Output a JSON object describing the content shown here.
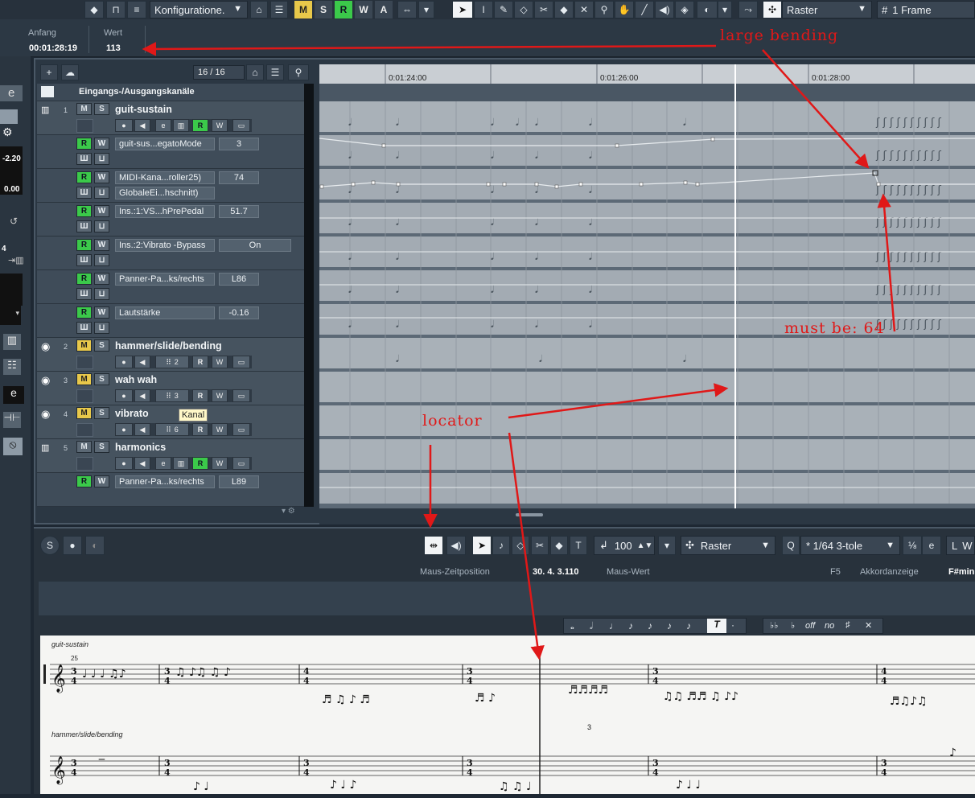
{
  "toolbar": {
    "config_label": "Konfiguratione.",
    "modes": [
      "M",
      "S",
      "R",
      "W",
      "A"
    ],
    "snap_label": "Raster",
    "quantize_label": "1 Frame"
  },
  "infoline": {
    "start_label": "Anfang",
    "start_value": "00:01:28:19",
    "value_label": "Wert",
    "value_value": "113"
  },
  "left_panel": {
    "vals": [
      "-2.20",
      "0.00",
      "4"
    ]
  },
  "project": {
    "track_counter": "16 / 16",
    "folder_name": "Eingangs-/Ausgangskanäle",
    "ruler_labels": [
      "0:01:24:00",
      "0:01:26:00",
      "0:01:28:00"
    ],
    "tracks": [
      {
        "num": "1",
        "name": "guit-sustain"
      },
      {
        "num": "2",
        "name": "hammer/slide/bending",
        "channel": "2"
      },
      {
        "num": "3",
        "name": "wah wah",
        "channel": "3"
      },
      {
        "num": "4",
        "name": "vibrato",
        "channel": "6"
      },
      {
        "num": "5",
        "name": "harmonics"
      }
    ],
    "automation": [
      {
        "param": "guit-sus...egatoMode",
        "value": "3"
      },
      {
        "param": "MIDI-Kana...roller25)",
        "value": "74",
        "sub": "GlobaleEi...hschnitt)"
      },
      {
        "param": "Ins.:1:VS...hPrePedal",
        "value": "51.7"
      },
      {
        "param": "Ins.:2:Vibrato -Bypass",
        "value": "On"
      },
      {
        "param": "Panner-Pa...ks/rechts",
        "value": "L86"
      },
      {
        "param": "Lautstärke",
        "value": "-0.16"
      },
      {
        "param": "Panner-Pa...ks/rechts",
        "value": "L89"
      }
    ],
    "tooltip": "Kanal"
  },
  "annotations": {
    "large_bending": "large bending",
    "must_be": "must be: 64",
    "locator": "locator"
  },
  "lower": {
    "velocity": "100",
    "snap": "Raster",
    "quantize": "* 1/64  3-tole",
    "mouse_pos_label": "Maus-Zeitposition",
    "mouse_pos_value": "30. 4. 3.110",
    "mouse_value_label": "Maus-Wert",
    "key_label": "F5",
    "chord_label": "Akkordanzeige",
    "chord_value": "F#min",
    "note_tools": [
      "T",
      "·"
    ],
    "accidentals": [
      "off",
      "no"
    ],
    "staff1_name": "guit-sustain",
    "staff2_name": "hammer/slide/bending",
    "bar_number": "25",
    "time_sig": "3/4",
    "tuplet3": "3"
  },
  "colors": {
    "accent_green": "#3bc94a",
    "accent_yellow": "#e8c84a",
    "annotation_red": "#e01818"
  }
}
